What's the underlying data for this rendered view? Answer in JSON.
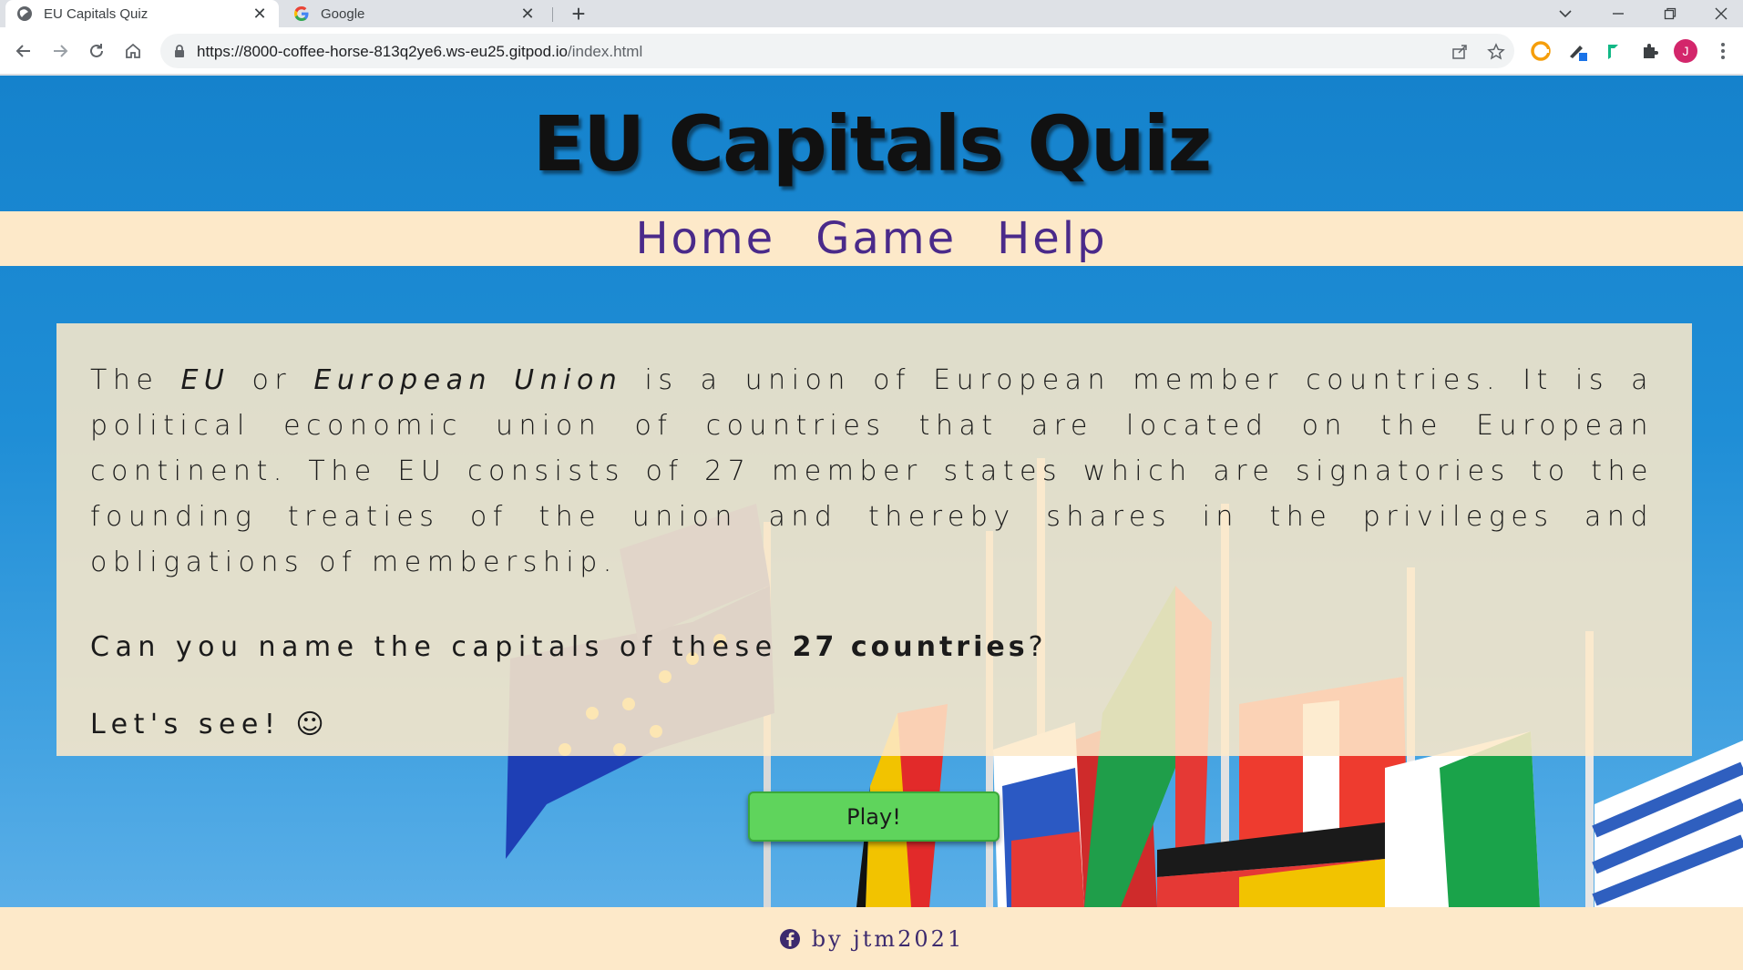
{
  "browser": {
    "tabs": [
      {
        "title": "EU Capitals Quiz",
        "active": true,
        "favicon": "globe-icon"
      },
      {
        "title": "Google",
        "active": false,
        "favicon": "google-g-icon"
      }
    ],
    "url_host": "https://8000-coffee-horse-813q2ye6.ws-eu25.gitpod.io",
    "url_path": "/index.html",
    "profile_initial": "J"
  },
  "site": {
    "title": "EU Capitals Quiz",
    "nav": [
      {
        "label": "Home"
      },
      {
        "label": "Game"
      },
      {
        "label": "Help"
      }
    ],
    "intro": {
      "p1_the": "The ",
      "p1_eu": "EU",
      "p1_or": " or ",
      "p1_european_union": "European Union",
      "p1_rest": " is a union of European member countries. It is a political economic union of countries that are located on the European continent. The EU consists of 27 member states which are signatories to the founding treaties of the union and thereby shares in the privileges and obligations of membership.",
      "question_pre": "Can you name the capitals of these ",
      "question_bold": "27 countries",
      "question_post": "?",
      "lets_see": "Let's see! ☺"
    },
    "play_label": "Play!",
    "footer_text": "by jtm2021"
  },
  "colors": {
    "header_blue": "#1582cc",
    "nav_cream": "#fde9c9",
    "nav_text": "#4a2a8a",
    "play_green": "#5fd45c"
  }
}
